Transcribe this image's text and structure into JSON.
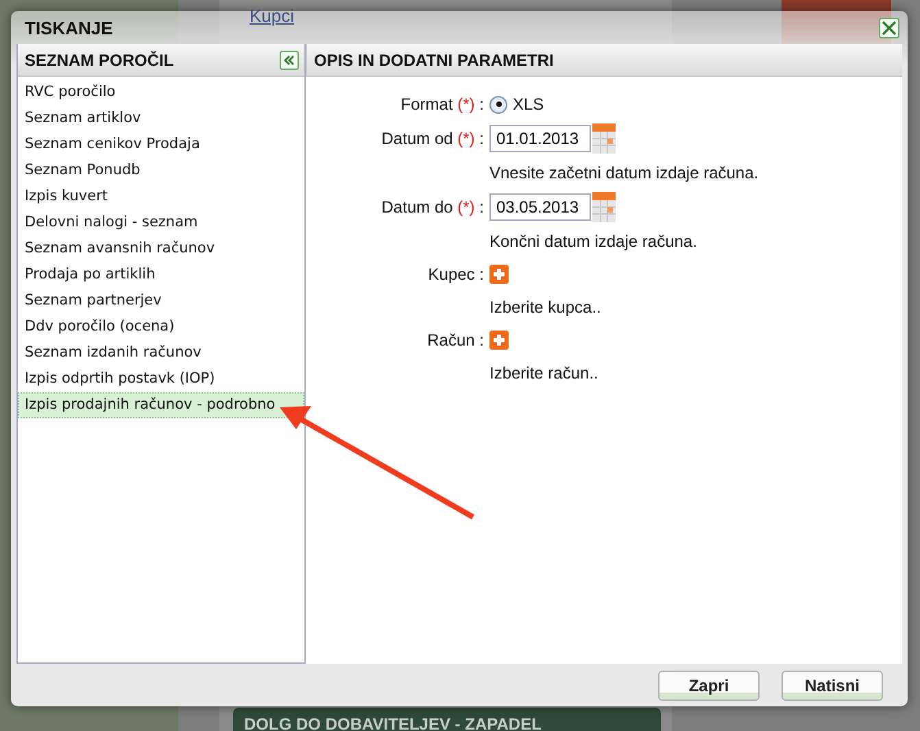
{
  "background": {
    "link": "Kupci",
    "panel_title": "DOLG DO DOBAVITELJEV - ZAPADEL"
  },
  "dialog": {
    "title": "TISKANJE"
  },
  "report_list": {
    "title": "SEZNAM POROČIL",
    "items": [
      {
        "label": "RVC poročilo",
        "selected": false
      },
      {
        "label": "Seznam artiklov",
        "selected": false
      },
      {
        "label": "Seznam cenikov Prodaja",
        "selected": false
      },
      {
        "label": "Seznam Ponudb",
        "selected": false
      },
      {
        "label": "Izpis kuvert",
        "selected": false
      },
      {
        "label": "Delovni nalogi - seznam",
        "selected": false
      },
      {
        "label": "Seznam avansnih računov",
        "selected": false
      },
      {
        "label": "Prodaja po artiklih",
        "selected": false
      },
      {
        "label": "Seznam partnerjev",
        "selected": false
      },
      {
        "label": "Ddv poročilo (ocena)",
        "selected": false
      },
      {
        "label": "Seznam izdanih računov",
        "selected": false
      },
      {
        "label": "Izpis odprtih postavk (IOP)",
        "selected": false
      },
      {
        "label": "Izpis prodajnih računov - podrobno",
        "selected": true
      }
    ]
  },
  "parameters": {
    "title": "OPIS IN DODATNI PARAMETRI",
    "fields": [
      {
        "kind": "radio",
        "label": "Format",
        "required_mark": "(*)",
        "separator": ":",
        "option": "XLS",
        "selected": true
      },
      {
        "kind": "date",
        "label": "Datum od",
        "required_mark": "(*)",
        "separator": ":",
        "value": "01.01.2013",
        "hint": "Vnesite začetni datum izdaje računa."
      },
      {
        "kind": "date",
        "label": "Datum do",
        "required_mark": "(*)",
        "separator": ":",
        "value": "03.05.2013",
        "hint": "Končni datum izdaje računa."
      },
      {
        "kind": "picker",
        "label": "Kupec",
        "separator": ":",
        "hint": "Izberite kupca.."
      },
      {
        "kind": "picker",
        "label": "Račun",
        "separator": ":",
        "hint": "Izberite račun.."
      }
    ]
  },
  "buttons": [
    "Zapri",
    "Natisni"
  ]
}
